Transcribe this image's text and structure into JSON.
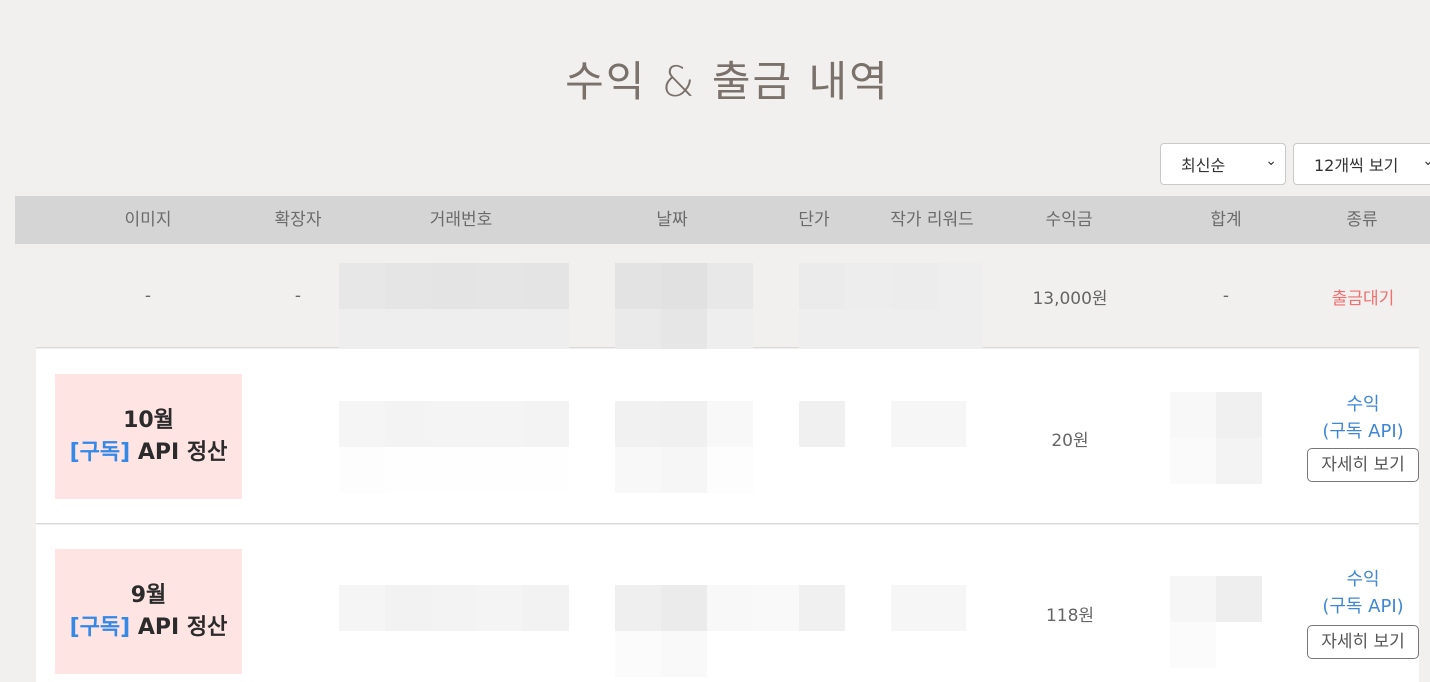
{
  "title": "수익 & 출금 내역",
  "controls": {
    "sort_value": "최신순",
    "per_page_value": "12개씩 보기"
  },
  "table": {
    "columns": [
      "이미지",
      "확장자",
      "거래번호",
      "날짜",
      "단가",
      "작가 리워드",
      "수익금",
      "합계",
      "종류"
    ],
    "rows": [
      {
        "image": "-",
        "extension": "-",
        "amount": "13,000원",
        "total": "-",
        "kind": "출금대기"
      },
      {
        "thumb_month": "10월",
        "thumb_tag": "[구독]",
        "thumb_rest": " API 정산",
        "amount": "20원",
        "kind_line1": "수익",
        "kind_line2": "(구독 API)",
        "detail_label": "자세히 보기"
      },
      {
        "thumb_month": "9월",
        "thumb_tag": "[구독]",
        "thumb_rest": " API 정산",
        "amount": "118원",
        "kind_line1": "수익",
        "kind_line2": "(구독 API)",
        "detail_label": "자세히 보기"
      }
    ]
  },
  "colors": {
    "pending": "#f07070",
    "income": "#3f87d6",
    "header_bg": "#d5d5d5"
  }
}
